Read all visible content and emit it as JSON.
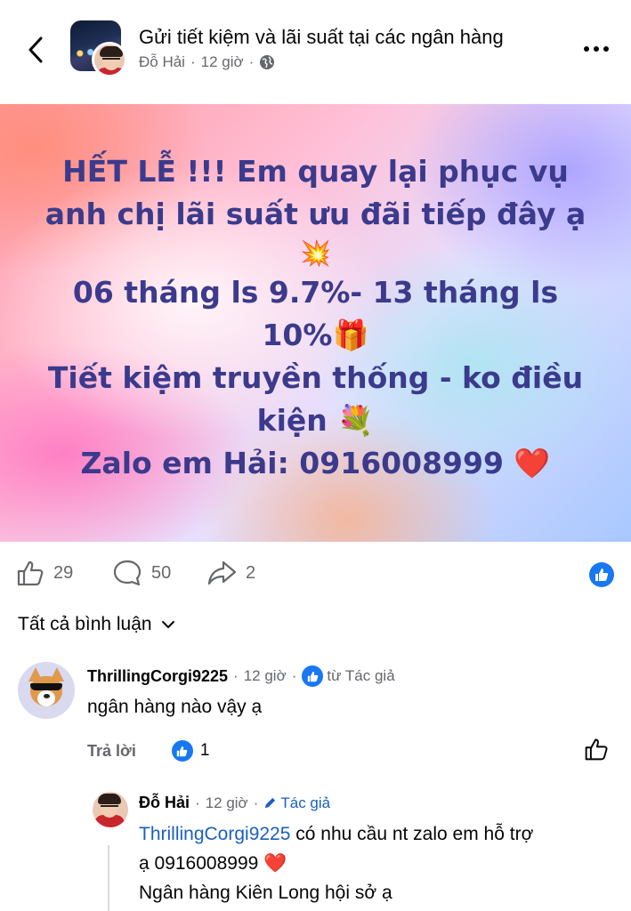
{
  "header": {
    "title": "Gửi tiết kiệm và lãi suất tại các ngân hàng",
    "author": "Đỗ Hải",
    "time": "12 giờ",
    "dot": "·"
  },
  "post": {
    "lines": [
      "HẾT LỄ !!! Em quay lại phục vụ",
      "anh chị lãi suất ưu đãi tiếp đây ạ",
      "💥",
      "06 tháng ls 9.7%- 13 tháng ls",
      "10%🎁",
      "Tiết kiệm truyền thống - ko điều",
      "kiện 💐",
      "Zalo em Hải: 0916008999 ❤️"
    ]
  },
  "reactions": {
    "likes": "29",
    "comments": "50",
    "shares": "2"
  },
  "comments_filter": {
    "label": "Tất cả bình luận"
  },
  "comments": [
    {
      "name": "ThrillingCorgi9225",
      "time": "12 giờ",
      "badge": "từ Tác giả",
      "text": "ngân hàng nào vậy ạ",
      "reply_label": "Trả lời",
      "like_count": "1"
    },
    {
      "name": "Đỗ Hải",
      "time": "12 giờ",
      "badge": "Tác giả",
      "mention": "ThrillingCorgi9225",
      "text_after_mention": " có nhu cầu nt zalo em hỗ trợ",
      "line2": "ạ 0916008999 ❤️",
      "line3": "Ngân hàng Kiên Long hội sở ạ"
    }
  ],
  "colors": {
    "accent": "#1877f2",
    "post_text": "#3b3a8c",
    "secondary_text": "#65676b",
    "mention": "#1b5fc1"
  }
}
